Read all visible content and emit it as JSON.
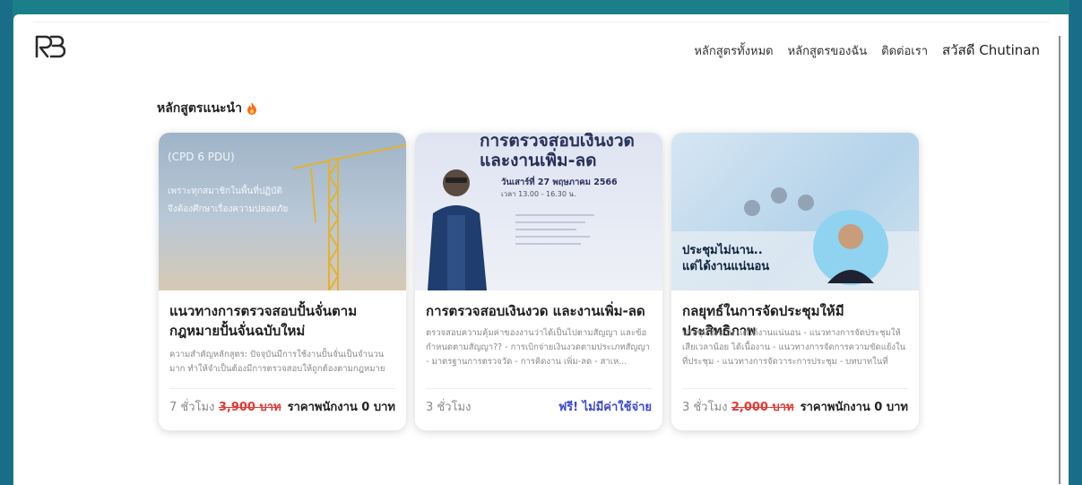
{
  "header": {
    "nav": [
      "หลักสูตรทั้งหมด",
      "หลักสูตรของฉัน",
      "ติดต่อเรา"
    ],
    "greeting": "สวัสดี Chutinan"
  },
  "section": {
    "title": "หลักสูตรแนะนำ"
  },
  "courses": [
    {
      "image_text": [
        "(CPD 6 PDU)",
        "เพราะทุกสมาชิกในพื้นที่ปฏิบัติ",
        "จึงต้องศึกษาเรื่องความปลอดภัย"
      ],
      "title": "แนวทางการตรวจสอบปั้นจั่นตามกฎหมายปั้นจั่นฉบับใหม่",
      "desc": "ความสำคัญหลักสูตร: ปัจจุบันมีการใช้งานปั้นจั่นเป็นจำนวนมาก ทำให้จำเป็นต้องมีการตรวจสอบให้ถูกต้องตามกฎหมาย",
      "hours": "7 ชั่วโมง",
      "old_price": "3,900 บาท",
      "staff_price": "ราคาพนักงาน 0 บาท"
    },
    {
      "image_text": [
        "การตรวจสอบเงินงวด",
        "และงานเพิ่ม-ลด",
        "วันเสาร์ที่ 27 พฤษภาคม 2566",
        "เวลา 13.00 - 16.30 น."
      ],
      "title": "การตรวจสอบเงินงวด และงานเพิ่ม-ลด",
      "desc": "ตรวจสอบความคุ้มค่าของงานว่าได้เป็นไปตามสัญญา และข้อกำหนดตามสัญญา?? - การเบิกจ่ายเงินงวดตามประเภทสัญญา - มาตรฐานการตรวจวัด - การคิดงาน เพิ่ม-ลด - สาเห...",
      "hours": "3 ชั่วโมง",
      "free_label": "ฟรี! ไม่มีค่าใช้จ่าย"
    },
    {
      "image_text": [
        "ประชุมไม่นาน..",
        "แต่ได้งานแน่นอน"
      ],
      "title": "กลยุทธ์ในการจัดประชุมให้มีประสิทธิภาพ",
      "desc": "ประชุมไม่นาน แต่ได้งานแน่นอน - แนวทางการจัดประชุมให้เสียเวลาน้อย ได้เนื้องาน - แนวทางการจัดการความขัดแย้งในที่ประชุม - แนวทางการจัดวาระการประชุม - บทบาทในที่ประชุม เหมาะสำหรั...",
      "hours": "3 ชั่วโมง",
      "old_price": "2,000 บาท",
      "staff_price": "ราคาพนักงาน 0 บาท"
    }
  ],
  "colors": {
    "frame": "#1b7f8a",
    "strike": "#e53935",
    "free": "#3b48d6"
  },
  "icons": {
    "logo": "rb-logo",
    "section": "fire-icon"
  }
}
